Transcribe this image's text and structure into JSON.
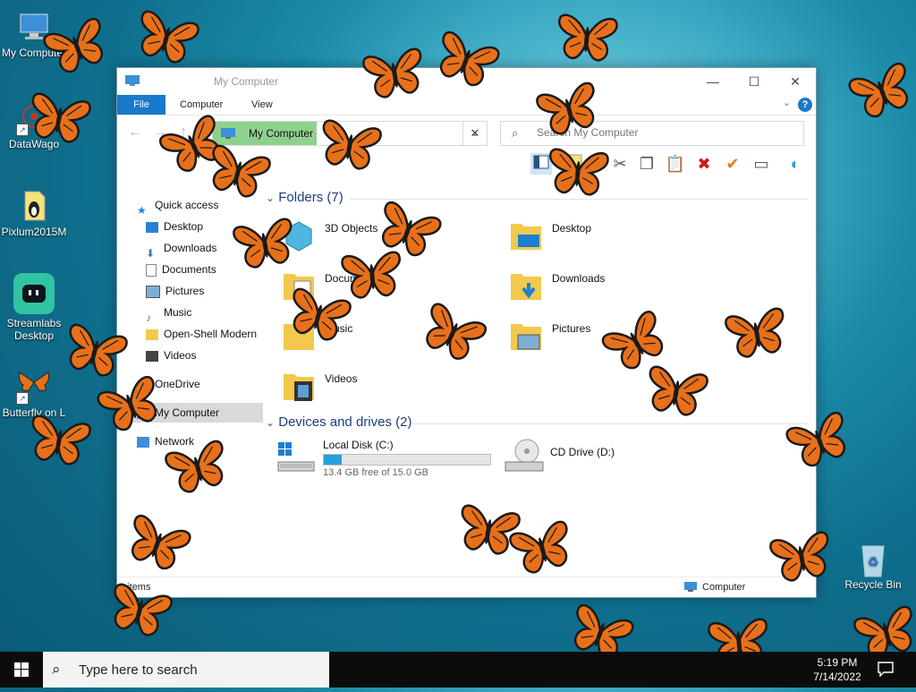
{
  "desktop": {
    "icons": [
      {
        "label": "My Computer",
        "icon": "monitor-icon"
      },
      {
        "label": "DataWago",
        "icon": "datawago-icon"
      },
      {
        "label": "Pixlum2015M",
        "icon": "pixlum-icon"
      },
      {
        "label": "Streamlabs Desktop",
        "icon": "streamlabs-icon"
      },
      {
        "label": "Butterfly on L",
        "icon": "butterfly-shortcut-icon"
      },
      {
        "label": "Recycle Bin",
        "icon": "recycle-bin-icon"
      }
    ]
  },
  "window": {
    "title": "My Computer",
    "tabs": {
      "file": "File",
      "computer": "Computer",
      "view": "View"
    },
    "help": "?",
    "address": {
      "crumb": "My Computer"
    },
    "search": {
      "placeholder": "Search My Computer"
    },
    "sidebar": {
      "quick_access": "Quick access",
      "items": [
        "Desktop",
        "Downloads",
        "Documents",
        "Pictures",
        "Music",
        "Open-Shell Modern",
        "Videos"
      ],
      "onedrive": "OneDrive",
      "my_computer": "My Computer",
      "network": "Network"
    },
    "folders_header": "Folders (7)",
    "folders": [
      "3D Objects",
      "Desktop",
      "Documents",
      "Downloads",
      "Music",
      "Pictures",
      "Videos"
    ],
    "devices_header": "Devices and drives (2)",
    "drives": [
      {
        "name": "Local Disk (C:)",
        "free": "13.4 GB free of 15.0 GB",
        "used_fraction": 0.11
      },
      {
        "name": "CD Drive (D:)"
      }
    ],
    "status": {
      "items": "0 items",
      "location": "Computer"
    }
  },
  "taskbar": {
    "search_placeholder": "Type here to search",
    "time": "5:19 PM",
    "date": "7/14/2022"
  },
  "colors": {
    "accent": "#1979ca",
    "address_highlight": "#8fd08f",
    "drive_fill": "#26a0da",
    "butterfly_orange": "#e8701a"
  }
}
